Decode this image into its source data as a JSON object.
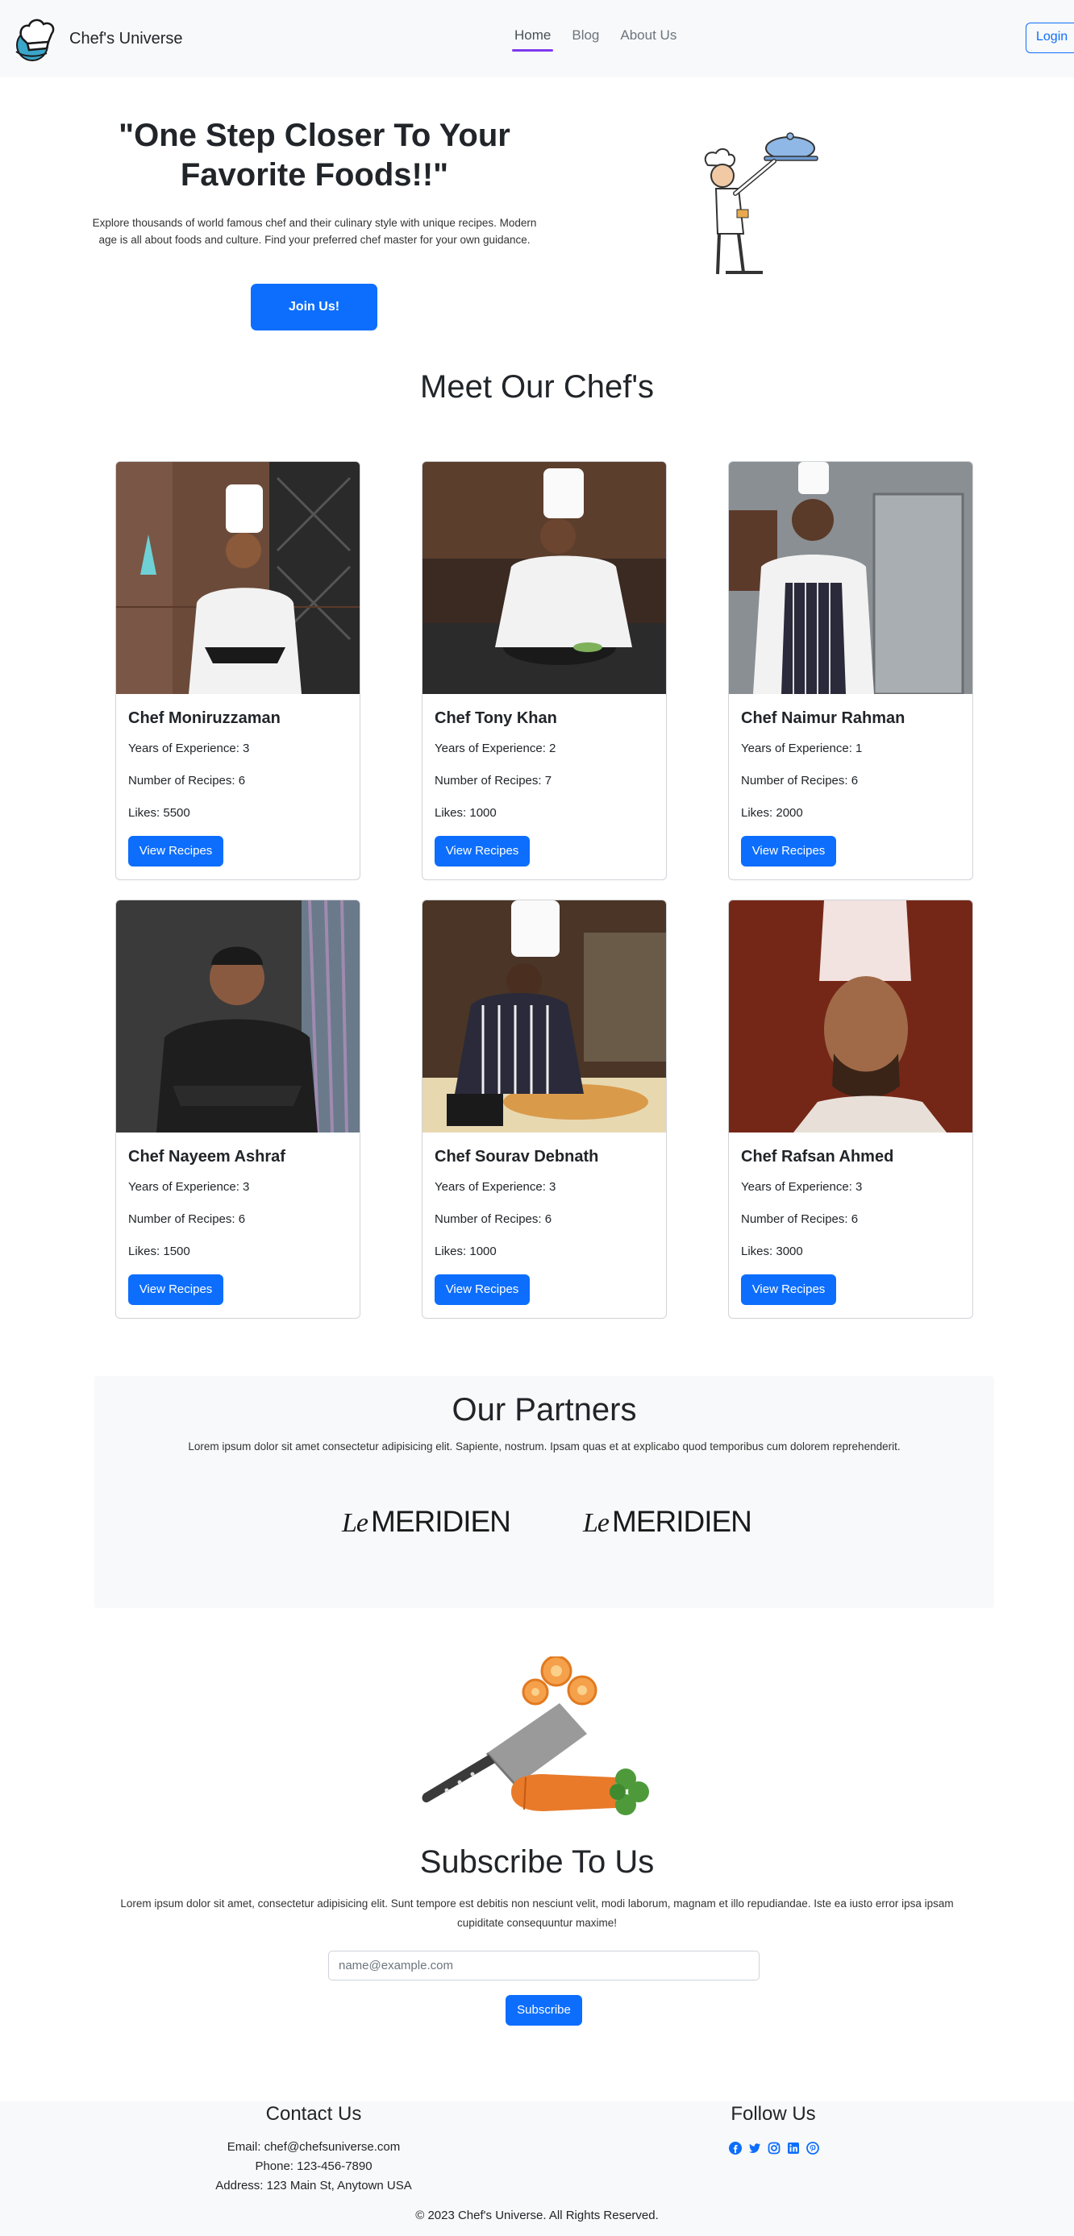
{
  "navbar": {
    "brand": "Chef's Universe",
    "links": [
      "Home",
      "Blog",
      "About Us"
    ],
    "login": "Login"
  },
  "hero": {
    "title": "\"One Step Closer To Your Favorite Foods!!\"",
    "text": "Explore thousands of world famous chef and their culinary style with unique recipes. Modern age is all about foods and culture. Find your preferred chef master for your own guidance.",
    "cta": "Join Us!"
  },
  "chefs_section": {
    "title": "Meet Our Chef's",
    "view_label": "View Recipes",
    "chefs": [
      {
        "name": "Chef Moniruzzaman",
        "experience": "Years of Experience: 3",
        "recipes": "Number of Recipes: 6",
        "likes": "Likes: 5500"
      },
      {
        "name": "Chef Tony Khan",
        "experience": "Years of Experience: 2",
        "recipes": "Number of Recipes: 7",
        "likes": "Likes: 1000"
      },
      {
        "name": "Chef Naimur Rahman",
        "experience": "Years of Experience: 1",
        "recipes": "Number of Recipes: 6",
        "likes": "Likes: 2000"
      },
      {
        "name": "Chef Nayeem Ashraf",
        "experience": "Years of Experience: 3",
        "recipes": "Number of Recipes: 6",
        "likes": "Likes: 1500"
      },
      {
        "name": "Chef Sourav Debnath",
        "experience": "Years of Experience: 3",
        "recipes": "Number of Recipes: 6",
        "likes": "Likes: 1000"
      },
      {
        "name": "Chef Rafsan Ahmed",
        "experience": "Years of Experience: 3",
        "recipes": "Number of Recipes: 6",
        "likes": "Likes: 3000"
      }
    ]
  },
  "partners": {
    "title": "Our Partners",
    "text": "Lorem ipsum dolor sit amet consectetur adipisicing elit. Sapiente, nostrum. Ipsam quas et at explicabo quod temporibus cum dolorem reprehenderit.",
    "logos": [
      {
        "le": "Le",
        "name": "MERIDIEN"
      },
      {
        "le": "Le",
        "name": "MERIDIEN"
      }
    ]
  },
  "subscribe": {
    "title": "Subscribe To Us",
    "text": "Lorem ipsum dolor sit amet, consectetur adipisicing elit. Sunt tempore est debitis non nesciunt velit, modi laborum, magnam et illo repudiandae. Iste ea iusto error ipsa ipsam cupiditate consequuntur maxime!",
    "placeholder": "name@example.com",
    "button": "Subscribe"
  },
  "footer": {
    "contact_title": "Contact Us",
    "email": "Email: chef@chefsuniverse.com",
    "phone": "Phone: 123-456-7890",
    "address": "Address: 123 Main St, Anytown USA",
    "follow_title": "Follow Us",
    "social_icons": [
      "facebook-icon",
      "twitter-icon",
      "instagram-icon",
      "linkedin-icon",
      "pinterest-icon"
    ],
    "social_color": "#0d6efd",
    "copyright": "© 2023 Chef's Universe. All Rights Reserved."
  },
  "colors": {
    "primary": "#0d6efd",
    "nav_active": "#7c3aed",
    "light_bg": "#f8f9fa"
  }
}
